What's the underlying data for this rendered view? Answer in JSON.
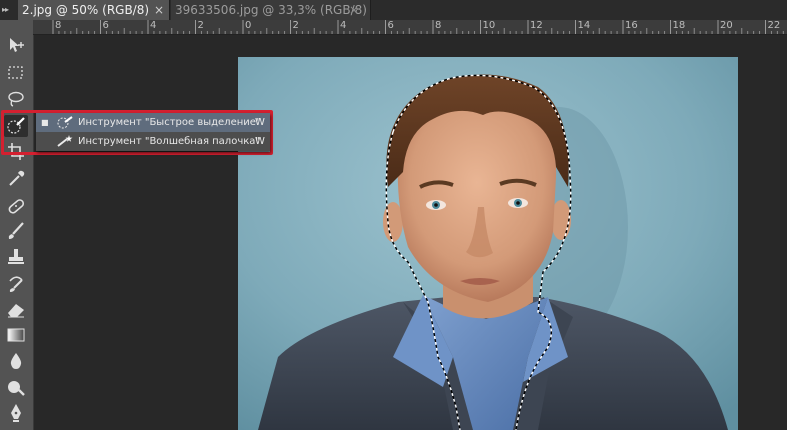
{
  "tabs": {
    "collapse_glyph": "▸▸",
    "active": {
      "label": "2.jpg @ 50% (RGB/8)",
      "close": "×"
    },
    "inactive": {
      "label": "39633506.jpg @ 33,3% (RGB/8)",
      "close": "×"
    }
  },
  "ruler": {
    "labels": [
      "8",
      "6",
      "4",
      "2",
      "0",
      "2",
      "4",
      "6",
      "8",
      "10",
      "12",
      "14",
      "16",
      "18",
      "20",
      "22"
    ]
  },
  "toolbar": {
    "tools": [
      "move-icon",
      "marquee-icon",
      "lasso-icon",
      "quick-selection-icon",
      "crop-icon",
      "eyedropper-icon",
      "healing-brush-icon",
      "brush-icon",
      "clone-stamp-icon",
      "history-brush-icon",
      "eraser-icon",
      "gradient-icon",
      "blur-icon",
      "dodge-icon",
      "pen-icon"
    ],
    "active_tool": "quick-selection-icon"
  },
  "flyout": {
    "items": [
      {
        "label": "Инструмент \"Быстрое выделение\"",
        "shortcut": "W",
        "selected": true,
        "bullet": "■",
        "icon": "quick-selection-icon"
      },
      {
        "label": "Инструмент \"Волшебная палочка\"",
        "shortcut": "W",
        "selected": false,
        "icon": "magic-wand-icon"
      }
    ]
  },
  "colors": {
    "highlight": "#d42030",
    "selected_item": "#5f6c7d",
    "photo_background": "#8ab3c0"
  },
  "document": {
    "description_icon": "photo-canvas"
  }
}
